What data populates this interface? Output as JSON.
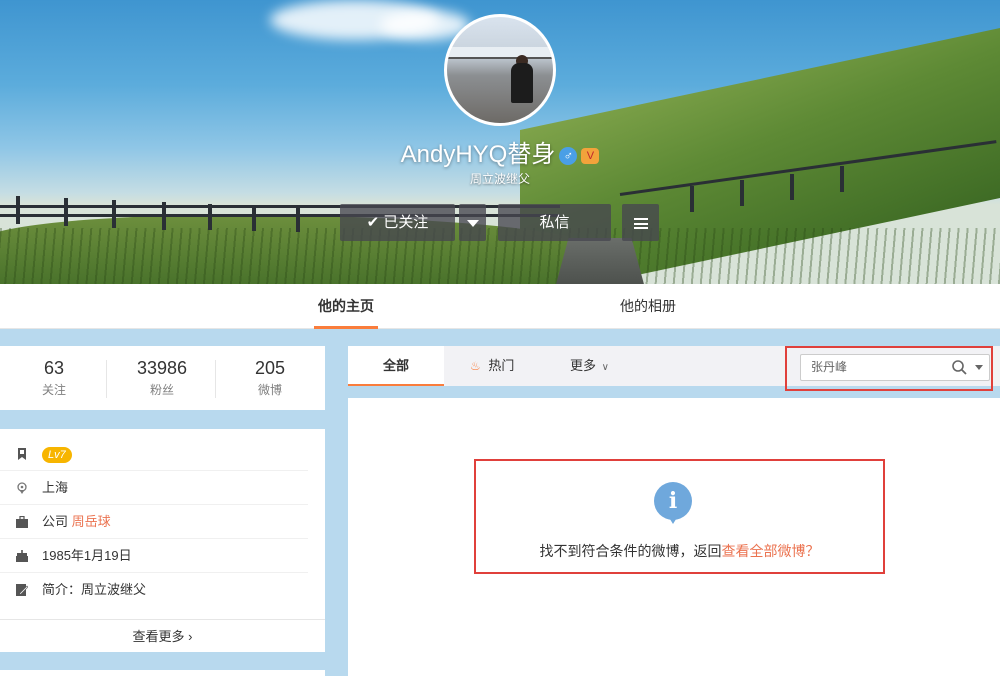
{
  "profile": {
    "name": "AndyHYQ替身",
    "gender_symbol": "♂",
    "vip_symbol": "V",
    "subtitle": "周立波继父",
    "follow_button": "已关注",
    "message_button": "私信"
  },
  "tabs": [
    {
      "label": "他的主页",
      "active": true
    },
    {
      "label": "他的相册",
      "active": false
    }
  ],
  "stats": [
    {
      "count": "63",
      "label": "关注"
    },
    {
      "count": "33986",
      "label": "粉丝"
    },
    {
      "count": "205",
      "label": "微博"
    }
  ],
  "info": {
    "level": "Lv7",
    "location": "上海",
    "company_prefix": "公司",
    "company_name": "周岳球",
    "birthday": "1985年1月19日",
    "bio": "简介：周立波继父",
    "more": "查看更多 ›"
  },
  "feed_tabs": {
    "all": "全部",
    "hot": "热门",
    "more": "更多",
    "search_value": "张丹峰"
  },
  "empty_state": {
    "text": "找不到符合条件的微博，返回",
    "link": "查看全部微博？"
  },
  "colors": {
    "accent": "#fa7d3c",
    "link": "#eb7350",
    "highlight_border": "#e0403b",
    "level_badge": "#f7b500"
  },
  "icons": [
    "check-icon",
    "caret-down-icon",
    "menu-icon",
    "bookmark-icon",
    "location-icon",
    "briefcase-icon",
    "cake-icon",
    "edit-icon",
    "fire-icon",
    "search-icon",
    "info-icon"
  ]
}
